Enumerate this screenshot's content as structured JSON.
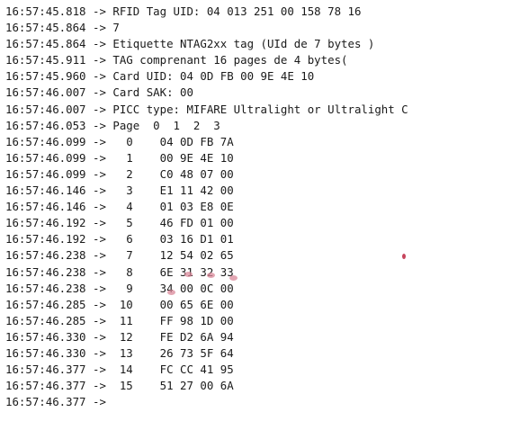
{
  "serial_monitor": {
    "lines": [
      {
        "ts": "16:57:45.818",
        "arrow": "->",
        "msg": "RFID Tag UID: 04 013 251 00 158 78 16"
      },
      {
        "ts": "16:57:45.864",
        "arrow": "->",
        "msg": "7"
      },
      {
        "ts": "16:57:45.864",
        "arrow": "->",
        "msg": "Etiquette NTAG2xx tag (UId de 7 bytes )"
      },
      {
        "ts": "16:57:45.911",
        "arrow": "->",
        "msg": "TAG comprenant 16 pages de 4 bytes("
      },
      {
        "ts": "16:57:45.960",
        "arrow": "->",
        "msg": "Card UID: 04 0D FB 00 9E 4E 10"
      },
      {
        "ts": "16:57:46.007",
        "arrow": "->",
        "msg": "Card SAK: 00"
      },
      {
        "ts": "16:57:46.007",
        "arrow": "->",
        "msg": "PICC type: MIFARE Ultralight or Ultralight C"
      },
      {
        "ts": "16:57:46.053",
        "arrow": "->",
        "msg": "Page  0  1  2  3"
      },
      {
        "ts": "16:57:46.099",
        "arrow": "->",
        "msg": "  0    04 0D FB 7A"
      },
      {
        "ts": "16:57:46.099",
        "arrow": "->",
        "msg": "  1    00 9E 4E 10"
      },
      {
        "ts": "16:57:46.099",
        "arrow": "->",
        "msg": "  2    C0 48 07 00"
      },
      {
        "ts": "16:57:46.146",
        "arrow": "->",
        "msg": "  3    E1 11 42 00"
      },
      {
        "ts": "16:57:46.146",
        "arrow": "->",
        "msg": "  4    01 03 E8 0E"
      },
      {
        "ts": "16:57:46.192",
        "arrow": "->",
        "msg": "  5    46 FD 01 00"
      },
      {
        "ts": "16:57:46.192",
        "arrow": "->",
        "msg": "  6    03 16 D1 01"
      },
      {
        "ts": "16:57:46.238",
        "arrow": "->",
        "msg": "  7    12 54 02 65"
      },
      {
        "ts": "16:57:46.238",
        "arrow": "->",
        "msg": "  8    6E 31 32 33"
      },
      {
        "ts": "16:57:46.238",
        "arrow": "->",
        "msg": "  9    34 00 0C 00"
      },
      {
        "ts": "16:57:46.285",
        "arrow": "->",
        "msg": " 10    00 65 6E 00"
      },
      {
        "ts": "16:57:46.285",
        "arrow": "->",
        "msg": " 11    FF 98 1D 00"
      },
      {
        "ts": "16:57:46.330",
        "arrow": "->",
        "msg": " 12    FE D2 6A 94"
      },
      {
        "ts": "16:57:46.330",
        "arrow": "->",
        "msg": " 13    26 73 5F 64"
      },
      {
        "ts": "16:57:46.377",
        "arrow": "->",
        "msg": " 14    FC CC 41 95"
      },
      {
        "ts": "16:57:46.377",
        "arrow": "->",
        "msg": " 15    51 27 00 6A"
      },
      {
        "ts": "16:57:46.377",
        "arrow": "->",
        "msg": ""
      }
    ]
  },
  "colors": {
    "text": "#1a1a1a",
    "background": "#ffffff",
    "highlight_mark": "#d9889a"
  }
}
